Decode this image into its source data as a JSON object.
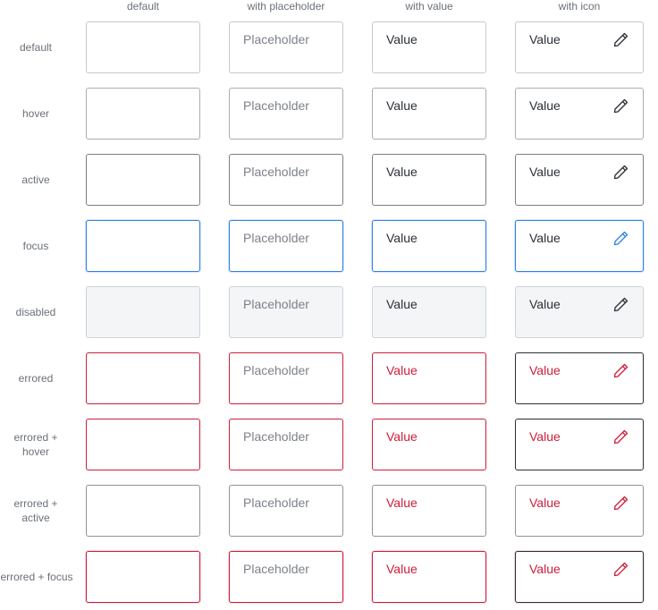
{
  "columns": [
    "default",
    "with placeholder",
    "with value",
    "with icon"
  ],
  "rows": [
    "default",
    "hover",
    "active",
    "focus",
    "disabled",
    "errored",
    "errored + hover",
    "errored + active",
    "errored + focus"
  ],
  "placeholder_text": "Placeholder",
  "value_text": "Value",
  "icon": "pencil-icon",
  "colors": {
    "border_default": "#c6c9ce",
    "border_hover": "#a9adb3",
    "border_active": "#7b7f86",
    "focus_blue": "#2f7fe8",
    "error_red": "#cc1e3a",
    "disabled_bg": "#f4f5f7",
    "text_value": "#2b2f36",
    "text_placeholder": "#7d8189"
  }
}
